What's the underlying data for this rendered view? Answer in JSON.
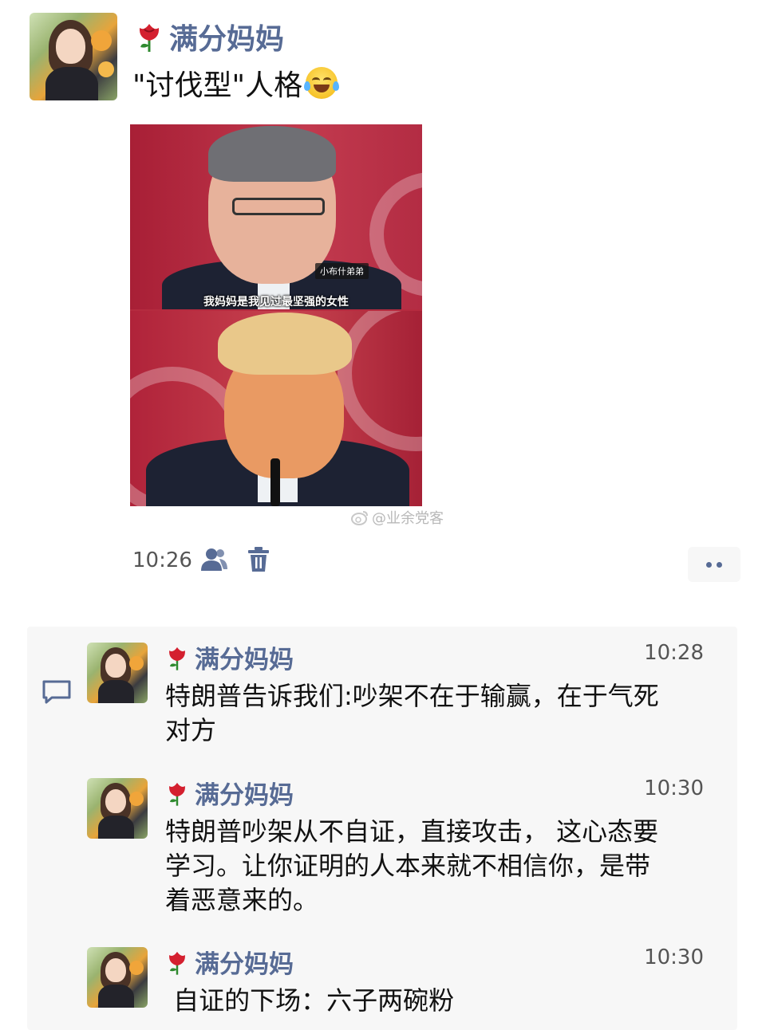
{
  "post": {
    "author": "满分妈妈",
    "text": "\"讨伐型\"人格",
    "emoji": "tears-of-joy-emoji",
    "image": {
      "caption": "我妈妈是我见过最坚强的女性",
      "name_tag": "小布什弟弟"
    },
    "watermark": "@业余党客",
    "time": "10:26"
  },
  "comments": [
    {
      "author": "满分妈妈",
      "time": "10:28",
      "text": "特朗普告诉我们:吵架不在于输赢，在于气死\n对方"
    },
    {
      "author": "满分妈妈",
      "time": "10:30",
      "text": "特朗普吵架从不自证，直接攻击， 这心态要\n学习。让你证明的人本来就不相信你，是带\n着恶意来的。"
    },
    {
      "author": "满分妈妈",
      "time": "10:30",
      "text": " 自证的下场：六子两碗粉"
    }
  ],
  "colors": {
    "name": "#576b95",
    "comment_bg": "#f7f7f7",
    "rose": "#d4202f"
  }
}
